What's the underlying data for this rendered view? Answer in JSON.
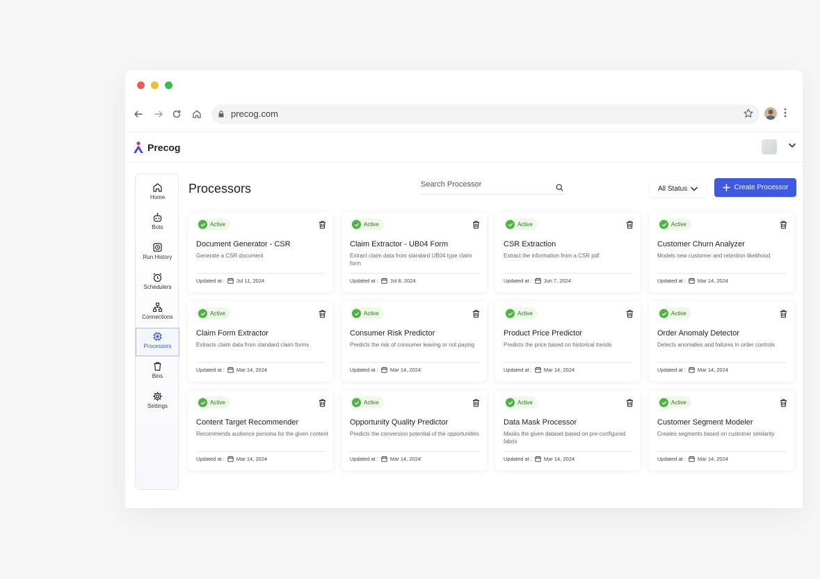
{
  "browser": {
    "url": "precog.com"
  },
  "app": {
    "brand": "Precog"
  },
  "sidebar": {
    "items": [
      {
        "label": "Home",
        "icon": "home-icon"
      },
      {
        "label": "Bots",
        "icon": "bot-icon"
      },
      {
        "label": "Run History",
        "icon": "history-icon"
      },
      {
        "label": "Schedulers",
        "icon": "alarm-icon"
      },
      {
        "label": "Connections",
        "icon": "network-icon"
      },
      {
        "label": "Processors",
        "icon": "chip-icon",
        "active": true
      },
      {
        "label": "Bins",
        "icon": "trash-icon"
      },
      {
        "label": "Settings",
        "icon": "gear-icon"
      }
    ]
  },
  "main": {
    "title": "Processors",
    "search_placeholder": "Search Processor",
    "status_filter": "All Status",
    "create_label": "Create Processor",
    "updated_label": "Updated at :",
    "accent_color": "#3d5ae0",
    "cards": [
      {
        "status": "Active",
        "title": "Document Generator - CSR",
        "description": "Generate a CSR document",
        "date": "Jul 11, 2024"
      },
      {
        "status": "Active",
        "title": "Claim Extractor - UB04 Form",
        "description": "Extract claim data from standard UB04 type claim form",
        "date": "Jul 8, 2024"
      },
      {
        "status": "Active",
        "title": "CSR Extraction",
        "description": "Extract the information from a CSR pdf",
        "date": "Jun 7, 2024"
      },
      {
        "status": "Active",
        "title": "Customer Churn Analyzer",
        "description": "Models new customer and retention likelihood",
        "date": "Mar 14, 2024"
      },
      {
        "status": "Active",
        "title": "Claim Form Extractor",
        "description": "Extracts claim data from standard claim forms",
        "date": "Mar 14, 2024"
      },
      {
        "status": "Active",
        "title": "Consumer Risk Predictor",
        "description": "Predicts the risk of consumer leaving or not paying",
        "date": "Mar 14, 2024"
      },
      {
        "status": "Active",
        "title": "Product Price Predictor",
        "description": "Predicts the price based on historical trends",
        "date": "Mar 14, 2024"
      },
      {
        "status": "Active",
        "title": "Order Anomaly Detector",
        "description": "Detects anomalies and failures in order controls",
        "date": "Mar 14, 2024"
      },
      {
        "status": "Active",
        "title": "Content Target Recommender",
        "description": "Recommends audience persona for the given content",
        "date": "Mar 14, 2024"
      },
      {
        "status": "Active",
        "title": "Opportunity Quality Predictor",
        "description": "Predicts the conversion potential of the opportunities",
        "date": "Mar 14, 2024"
      },
      {
        "status": "Active",
        "title": "Data Mask Processor",
        "description": "Masks the given dataset based on pre-configured fabrix",
        "date": "Mar 14, 2024"
      },
      {
        "status": "Active",
        "title": "Customer Segment Modeler",
        "description": "Creates segments based on customer similarity",
        "date": "Mar 14, 2024"
      }
    ]
  }
}
